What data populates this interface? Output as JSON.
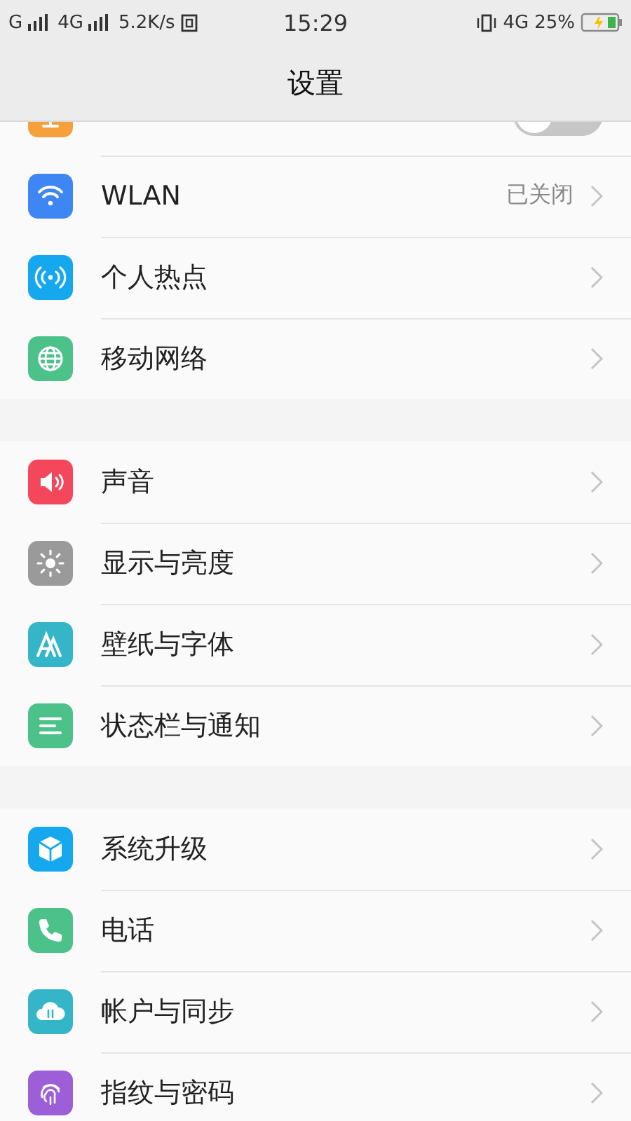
{
  "status_bar": {
    "left": [
      "G",
      "4G"
    ],
    "speed": "5.2K/s",
    "time": "15:29",
    "network": "4G",
    "battery": "25%",
    "charging": true
  },
  "header": {
    "title": "设置"
  },
  "groups": [
    {
      "items": [
        {
          "kind": "toggle",
          "color": "#f5a03a",
          "on": false
        },
        {
          "kind": "link",
          "color": "#3f86f5",
          "label": "WLAN",
          "value": "已关闭"
        },
        {
          "kind": "link",
          "color": "#16a8ee",
          "label": "个人热点"
        },
        {
          "kind": "link",
          "color": "#4cc28a",
          "label": "移动网络"
        }
      ]
    },
    {
      "items": [
        {
          "kind": "link",
          "color": "#f5475c",
          "label": "声音"
        },
        {
          "kind": "link",
          "color": "#9a9a9a",
          "label": "显示与亮度"
        },
        {
          "kind": "link",
          "color": "#34b6c8",
          "label": "壁纸与字体"
        },
        {
          "kind": "link",
          "color": "#4cc28a",
          "label": "状态栏与通知"
        }
      ]
    },
    {
      "items": [
        {
          "kind": "link",
          "color": "#16a8ee",
          "label": "系统升级"
        },
        {
          "kind": "link",
          "color": "#4cc28a",
          "label": "电话"
        },
        {
          "kind": "link",
          "color": "#34b6c8",
          "label": "帐户与同步"
        },
        {
          "kind": "link",
          "color": "#9c5fd8",
          "label": "指纹与密码"
        }
      ]
    }
  ]
}
